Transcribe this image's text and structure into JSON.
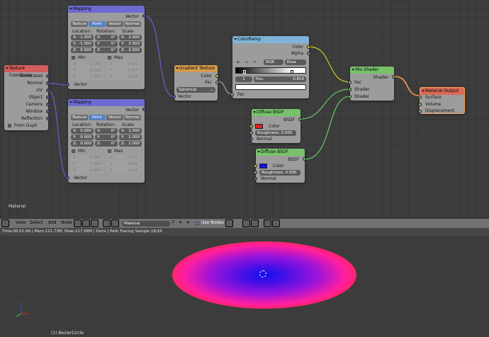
{
  "editor_label": "Material",
  "nodes": {
    "texcoord": {
      "title": "Texture Coordinate",
      "outputs": [
        "Generated",
        "Normal",
        "UV",
        "Object",
        "Camera",
        "Window",
        "Reflection"
      ],
      "option": "From Dupli"
    },
    "mapping1": {
      "title": "Mapping",
      "out": "Vector",
      "tabs": [
        "Texture",
        "Point",
        "Vector",
        "Normal"
      ],
      "hdr_loc": "Location:",
      "hdr_rot": "Rotation:",
      "hdr_scl": "Scale:",
      "loc": [
        [
          "X:",
          "-1.000"
        ],
        [
          "Y:",
          "-1.000"
        ],
        [
          "Z:",
          "0.000"
        ]
      ],
      "rot": [
        [
          "X:",
          "0°"
        ],
        [
          "Y:",
          "0°"
        ],
        [
          "Z:",
          "0°"
        ]
      ],
      "scl": [
        [
          "X:",
          "2.000"
        ],
        [
          "Y:",
          "2.000"
        ],
        [
          "Z:",
          "2.000"
        ]
      ],
      "min_label": "Min",
      "max_label": "Max",
      "min": [
        [
          "X:",
          "0.000"
        ],
        [
          "Y:",
          "0.000"
        ],
        [
          "Z:",
          "0.000"
        ]
      ],
      "max": [
        [
          "X:",
          "1.000"
        ],
        [
          "Y:",
          "1.000"
        ],
        [
          "Z:",
          "1.000"
        ]
      ],
      "in": "Vector"
    },
    "mapping2": {
      "title": "Mapping",
      "out": "Vector",
      "tabs": [
        "Texture",
        "Point",
        "Vector",
        "Normal"
      ],
      "hdr_loc": "Location:",
      "hdr_rot": "Rotation:",
      "hdr_scl": "Scale:",
      "loc": [
        [
          "X:",
          "0.000"
        ],
        [
          "Y:",
          "0.000"
        ],
        [
          "Z:",
          "0.000"
        ]
      ],
      "rot": [
        [
          "X:",
          "0°"
        ],
        [
          "Y:",
          "0°"
        ],
        [
          "Z:",
          "0°"
        ]
      ],
      "scl": [
        [
          "X:",
          "1.000"
        ],
        [
          "Y:",
          "1.000"
        ],
        [
          "Z:",
          "1.000"
        ]
      ],
      "min_label": "Min",
      "max_label": "Max",
      "min": [
        [
          "X:",
          "0.000"
        ],
        [
          "Y:",
          "0.000"
        ],
        [
          "Z:",
          "0.000"
        ]
      ],
      "max": [
        [
          "X:",
          "1.000"
        ],
        [
          "Y:",
          "1.000"
        ],
        [
          "Z:",
          "1.000"
        ]
      ],
      "in": "Vector"
    },
    "gradient": {
      "title": "Gradient Texture",
      "out_color": "Color",
      "out_fac": "Fac",
      "type": "Spherical",
      "in": "Vector"
    },
    "colorramp": {
      "title": "ColorRamp",
      "out_color": "Color",
      "out_alpha": "Alpha",
      "add": "+",
      "remove": "−",
      "flip": "‹›",
      "mode": "RGB",
      "interp": "Ease",
      "index": "1",
      "pos_label": "Pos:",
      "pos": "0.814",
      "in": "Fac"
    },
    "diffuse1": {
      "title": "Diffuse BSDF",
      "out": "BSDF",
      "color_label": "Color",
      "swatch": "#e02020",
      "rough_label": "Roughness:",
      "rough": "0.000",
      "normal": "Normal"
    },
    "diffuse2": {
      "title": "Diffuse BSDF",
      "out": "BSDF",
      "color_label": "Color",
      "swatch": "#1010e0",
      "rough_label": "Roughness:",
      "rough": "0.000",
      "normal": "Normal"
    },
    "mix": {
      "title": "Mix Shader",
      "out": "Shader",
      "in": [
        "Fac",
        "Shader",
        "Shader"
      ]
    },
    "output": {
      "title": "Material Output",
      "in": [
        "Surface",
        "Volume",
        "Displacement"
      ]
    }
  },
  "header": {
    "menus": [
      "View",
      "Select",
      "Add",
      "Node"
    ],
    "material_name": "Material",
    "fake_user": "F",
    "use_nodes": "Use Nodes"
  },
  "status": "Time:00:01.68 | Mem:121.73M, Peak:217.68M | Done | Path Tracing Sample 16/16",
  "viewport_label": "(1) BezierCircle"
}
